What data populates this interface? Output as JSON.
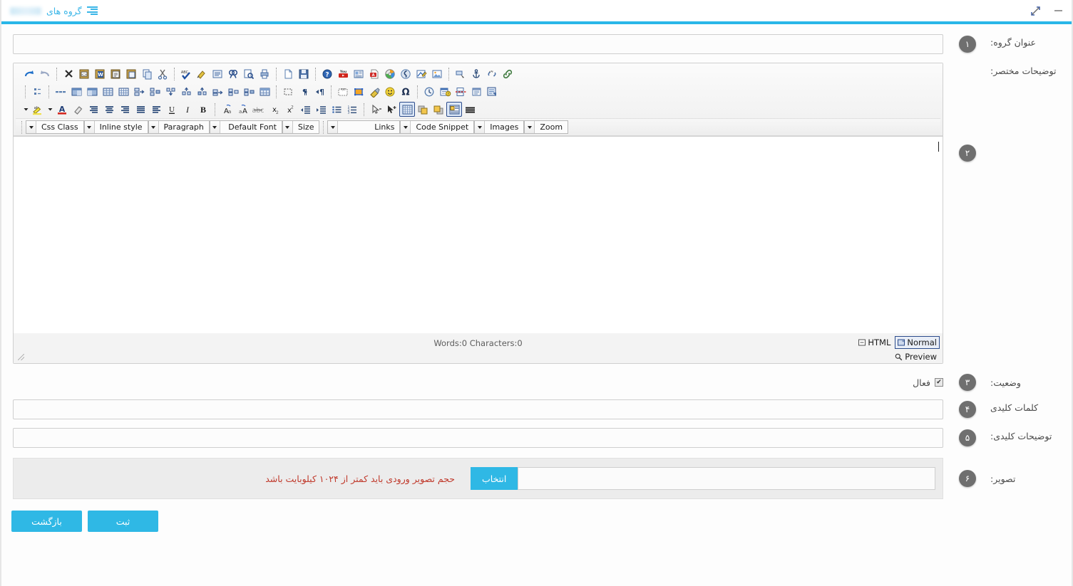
{
  "window": {
    "title": "گروه های",
    "minimize_label": "minimize",
    "expand_label": "expand"
  },
  "accent_color": "#29b6e8",
  "form": {
    "fields": [
      {
        "badge": "۱",
        "label": "عنوان گروه:",
        "value": "",
        "placeholder": ""
      },
      {
        "badge": "۲",
        "label": "توضیحات مختصر:",
        "value": "",
        "placeholder": ""
      },
      {
        "badge": "۳",
        "label": "وضعیت:",
        "checkbox_label": "فعال",
        "checked": true
      },
      {
        "badge": "۴",
        "label": "کلمات کلیدی",
        "value": "",
        "placeholder": ""
      },
      {
        "badge": "۵",
        "label": "توضیحات کلیدی:",
        "value": "",
        "placeholder": ""
      },
      {
        "badge": "۶",
        "label": "تصویر:",
        "value": "",
        "placeholder": ""
      }
    ]
  },
  "editor": {
    "content": "",
    "status": {
      "counts": "Words:0 Characters:0",
      "tab_html": "HTML",
      "tab_normal": "Normal",
      "tab_preview": "Preview",
      "active_tab": "Normal"
    },
    "dropdowns": [
      {
        "label": "Css Class"
      },
      {
        "label": "Inline style"
      },
      {
        "label": "Paragraph"
      },
      {
        "label": "Default Font"
      },
      {
        "label": "Size"
      },
      {
        "label": "Links"
      },
      {
        "label": "Code Snippet"
      },
      {
        "label": "Images"
      },
      {
        "label": "Zoom"
      }
    ],
    "toolbar_row1": [
      "redo-icon",
      "undo-icon",
      "sep",
      "remove-icon",
      "paste-html-icon",
      "paste-word-icon",
      "paste-text-icon",
      "paste-icon",
      "copy-icon",
      "cut-icon",
      "sep",
      "spellcheck-icon",
      "format-painter-icon",
      "select-all-icon",
      "find-icon",
      "find-replace-icon",
      "print-icon",
      "sep",
      "new-document-icon",
      "save-icon",
      "sep",
      "help-icon",
      "youtube-icon",
      "media-icon",
      "pdf-icon",
      "media-player-icon",
      "flash-icon",
      "signature-icon",
      "image-icon",
      "sep",
      "cursor-icon",
      "anchor-icon",
      "unlink-icon",
      "link-icon"
    ],
    "toolbar_row2": [
      "list-properties-icon",
      "sep",
      "hr-icon",
      "table-insert-icon",
      "table-properties-icon",
      "table-grid-icon",
      "table-grid2-icon",
      "row-insert-above-icon",
      "row-insert-below-icon",
      "row-delete-icon",
      "cell-insert-left-icon",
      "cell-insert-right-icon",
      "cell-merge-icon",
      "cell-split-icon",
      "cell-delete-icon",
      "table-cell-props-icon",
      "sep",
      "show-borders-icon",
      "rtl-icon",
      "ltr-icon",
      "sep",
      "abbreviation-icon",
      "div-container-icon",
      "cleanup-icon",
      "emoji-icon",
      "special-char-icon",
      "sep",
      "time-icon",
      "date-icon",
      "page-break-icon",
      "template-icon",
      "document-properties-icon"
    ],
    "toolbar_row3": [
      "dropdown-arrow",
      "highlight-icon",
      "dropdown-arrow",
      "font-color-icon",
      "eraser-icon",
      "justify-block-icon",
      "justify-center-icon",
      "align-right-icon",
      "justify-full-icon",
      "align-left-icon",
      "underline-icon",
      "italic-icon",
      "bold-icon",
      "sep",
      "uppercase-icon",
      "lowercase-icon",
      "strikethrough-icon",
      "subscript-icon",
      "superscript-icon",
      "outdent-icon",
      "indent-icon",
      "bullet-list-icon",
      "numbered-list-icon",
      "sep",
      "select-tool-icon",
      "select-add-icon",
      "grid-icon",
      "layer-back-icon",
      "layer-front-icon",
      "layout-icon",
      "horizontal-rule-icon"
    ]
  },
  "upload": {
    "note": "حجم تصویر ورودی باید کمتر از ۱۰۲۴ کیلوبایت باشد",
    "select_button": "انتخاب",
    "value": "",
    "placeholder": ""
  },
  "buttons": {
    "submit": "ثبت",
    "back": "بازگشت"
  }
}
